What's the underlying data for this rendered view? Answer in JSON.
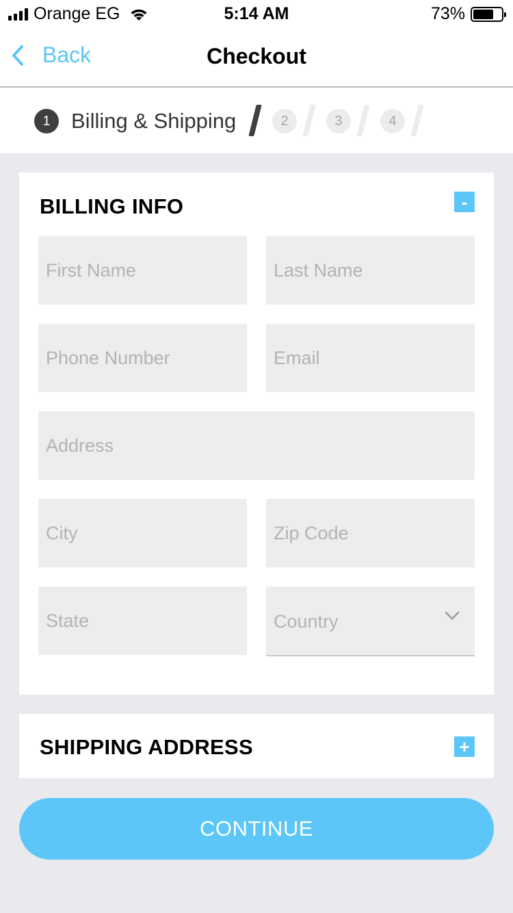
{
  "status_bar": {
    "carrier": "Orange EG",
    "time": "5:14 AM",
    "battery_percent": "73%",
    "battery_level": 0.73,
    "icons": [
      "signal-icon",
      "wifi-icon",
      "battery-icon"
    ]
  },
  "nav": {
    "back_label": "Back",
    "title": "Checkout",
    "back_icon": "chevron-left-icon"
  },
  "steps": {
    "current_number": "1",
    "current_label": "Billing & Shipping",
    "upcoming": [
      "2",
      "3",
      "4"
    ]
  },
  "billing": {
    "title": "BILLING INFO",
    "toggle_label": "-",
    "fields": {
      "first_name": "First Name",
      "last_name": "Last Name",
      "phone": "Phone Number",
      "email": "Email",
      "address": "Address",
      "city": "City",
      "zip": "Zip Code",
      "state": "State",
      "country": "Country"
    }
  },
  "shipping": {
    "title": "SHIPPING ADDRESS",
    "toggle_label": "+"
  },
  "continue_label": "CONTINUE",
  "colors": {
    "accent": "#5bc6f7",
    "background": "#e9e9ee",
    "field": "#ededed",
    "placeholder": "#b3b3b3"
  }
}
